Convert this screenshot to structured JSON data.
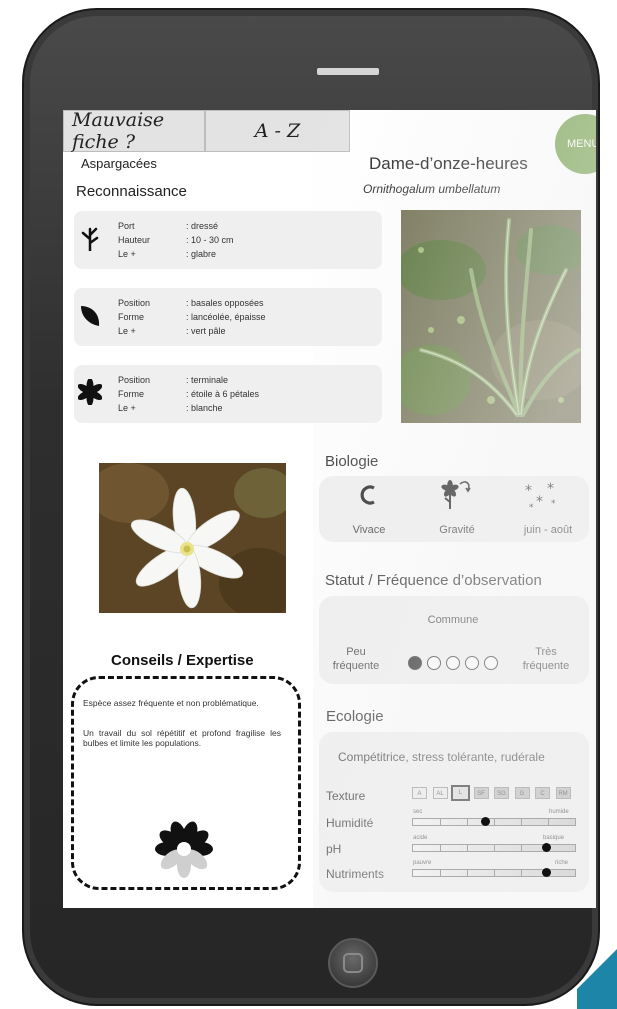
{
  "tabs": {
    "bad_sheet": "Mauvaise fiche ?",
    "a_z": "A - Z"
  },
  "menu_label": "MENU",
  "plant": {
    "family": "Aspargacées",
    "common_name": "Dame-d’onze-heures",
    "latin_name": "Ornithogalum umbellatum"
  },
  "recognition": {
    "title": "Reconnaissance",
    "cards": [
      {
        "icon": "stem-icon",
        "rows": [
          {
            "key": "Port",
            "value": ": dressé"
          },
          {
            "key": "Hauteur",
            "value": ": 10 - 30 cm"
          },
          {
            "key": "Le +",
            "value": ": glabre"
          }
        ]
      },
      {
        "icon": "leaf-icon",
        "rows": [
          {
            "key": "Position",
            "value": ": basales opposées"
          },
          {
            "key": "Forme",
            "value": ": lancéolée, épaisse"
          },
          {
            "key": "Le +",
            "value": ": vert pâle"
          }
        ]
      },
      {
        "icon": "flower-icon",
        "rows": [
          {
            "key": "Position",
            "value": ": terminale"
          },
          {
            "key": "Forme",
            "value": ": étoile à 6 pétales"
          },
          {
            "key": "Le +",
            "value": ": blanche"
          }
        ]
      }
    ]
  },
  "biology": {
    "title": "Biologie",
    "items": [
      {
        "icon": "perennial-icon",
        "label": "Vivace"
      },
      {
        "icon": "gravity-dispersal-icon",
        "label": "Gravité"
      },
      {
        "icon": "flowering-period-icon",
        "label": "juin - août"
      }
    ]
  },
  "status": {
    "title": "Statut / Fréquence d’observation",
    "value": "Commune",
    "low_label_1": "Peu",
    "low_label_2": "fréquente",
    "high_label_1": "Très",
    "high_label_2": "fréquente",
    "level": 1,
    "max_level": 5
  },
  "ecology": {
    "title": "Ecologie",
    "strategy": "Compétitrice, stress tolérante, rudérale",
    "texture": {
      "label": "Texture",
      "classes": [
        "A",
        "AL",
        "L",
        "SF",
        "SG",
        "G",
        "C",
        "RM"
      ],
      "selected": "L"
    },
    "scales": [
      {
        "label": "Humidité",
        "min": "sec",
        "max": "humide",
        "value": 0.45
      },
      {
        "label": "pH",
        "min": "acide",
        "max": "basique",
        "value": 0.82
      },
      {
        "label": "Nutriments",
        "min": "pauvre",
        "max": "riche",
        "value": 0.82
      }
    ]
  },
  "advice": {
    "title": "Conseils / Expertise",
    "paragraph_1": "Espèce assez fréquente et non problématique.",
    "paragraph_2": "Un travail du sol répétitif et profond fragilise les bulbes et limite les populations.",
    "icon": "expert-flower-icon"
  },
  "colors": {
    "menu_green": "#7aa552",
    "panel_grey": "#efefef",
    "device_body": "#2e2e2e"
  }
}
